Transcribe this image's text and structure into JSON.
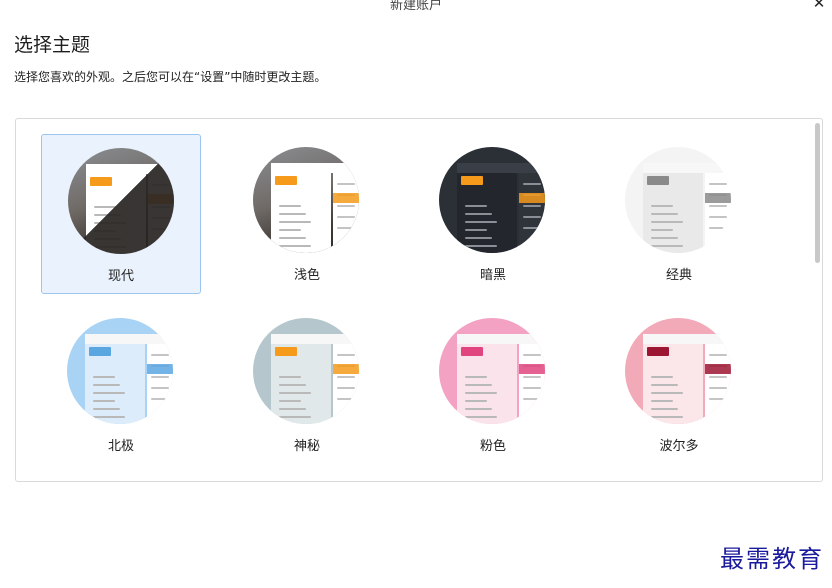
{
  "window": {
    "title": "新建账户",
    "close_symbol": "✕"
  },
  "page": {
    "heading": "选择主题",
    "subheading": "选择您喜欢的外观。之后您可以在“设置”中随时更改主题。"
  },
  "themes": [
    {
      "label": "现代",
      "selected": true,
      "preview": {
        "bg": "#ffffff",
        "side": "#ffffff",
        "accent": "#f59a1b",
        "text": "#333333",
        "photo": true,
        "dark": false
      }
    },
    {
      "label": "浅色",
      "selected": false,
      "preview": {
        "bg": "#ffffff",
        "side": "#ffffff",
        "accent": "#f59a1b",
        "text": "#333333",
        "photo": true,
        "dark": false
      }
    },
    {
      "label": "暗黑",
      "selected": false,
      "preview": {
        "bg": "#2b2f36",
        "side": "#23272d",
        "accent": "#f59a1b",
        "text": "#e6e6e6",
        "photo": false,
        "dark": true
      }
    },
    {
      "label": "经典",
      "selected": false,
      "preview": {
        "bg": "#f4f4f4",
        "side": "#e9e9e9",
        "accent": "#8a8a8a",
        "text": "#333333",
        "photo": false,
        "dark": false
      }
    },
    {
      "label": "北极",
      "selected": false,
      "preview": {
        "bg": "#a8d3f4",
        "side": "#dcecfa",
        "accent": "#5aa6e0",
        "text": "#333333",
        "photo": false,
        "dark": false
      }
    },
    {
      "label": "神秘",
      "selected": false,
      "preview": {
        "bg": "#b5c7cc",
        "side": "#e0e8ea",
        "accent": "#f59a1b",
        "text": "#333333",
        "photo": false,
        "dark": false
      }
    },
    {
      "label": "粉色",
      "selected": false,
      "preview": {
        "bg": "#f3a2c3",
        "side": "#fbe3ec",
        "accent": "#e0457f",
        "text": "#333333",
        "photo": false,
        "dark": false
      }
    },
    {
      "label": "波尔多",
      "selected": false,
      "preview": {
        "bg": "#f2a9b8",
        "side": "#fbe6ea",
        "accent": "#9c1633",
        "text": "#333333",
        "photo": false,
        "dark": false
      }
    }
  ],
  "watermark": "最需教育"
}
